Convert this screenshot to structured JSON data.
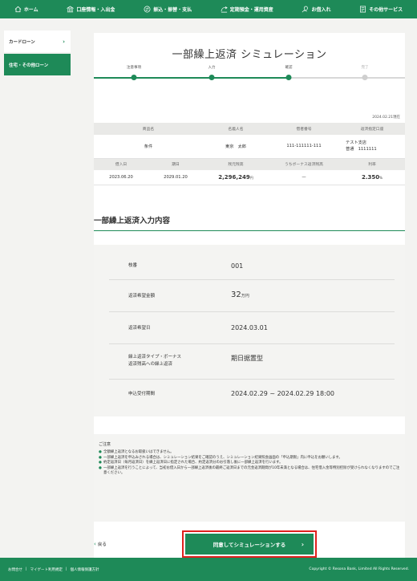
{
  "nav": {
    "items": [
      {
        "label": "ホーム",
        "icon": "home-icon"
      },
      {
        "label": "口座情報・入出金",
        "icon": "bank-icon"
      },
      {
        "label": "振込・振替・支払",
        "icon": "transfer-icon"
      },
      {
        "label": "定期預金・運用資産",
        "icon": "deposit-icon"
      },
      {
        "label": "お借入れ",
        "icon": "loan-icon"
      },
      {
        "label": "その他サービス",
        "icon": "services-icon"
      }
    ]
  },
  "sidebar": {
    "items": [
      {
        "label": "カードローン",
        "chevron": "›"
      },
      {
        "label": "住宅・その他ローン"
      }
    ]
  },
  "page": {
    "title": "一部繰上返済 シミュレーション",
    "steps": [
      {
        "label": "注意事項",
        "active": true
      },
      {
        "label": "入力",
        "active": true
      },
      {
        "label": "確認",
        "active": true
      },
      {
        "label": "完了",
        "active": false
      }
    ],
    "as_of": "2024.02.21現在"
  },
  "info_table": {
    "headers1": [
      "商品名",
      "名義人名",
      "借者番号",
      "返済指定口座"
    ],
    "product": "条件",
    "holder": "東京　太郎",
    "borrower_no": "111-111111-111",
    "account_line1": "テスト支店",
    "account_line2": "普通　1111111",
    "headers2": [
      "借入日",
      "期日",
      "残元残高",
      "うちボーナス返済残高",
      "利率"
    ],
    "loan_date": "2023.06.20",
    "due_date": "2029.01.20",
    "balance": "2,296,249",
    "balance_unit": "円",
    "bonus_balance": "—",
    "rate": "2.350",
    "rate_unit": "%"
  },
  "section": {
    "title": "一部繰上返済入力内容"
  },
  "details": {
    "branch_label": "枝番",
    "branch_value": "001",
    "amount_label": "返済希望金額",
    "amount_value": "32",
    "amount_unit": "万円",
    "date_label": "返済希望日",
    "date_value": "2024.03.01",
    "type_label_1": "繰上返済タイプ・ボーナス",
    "type_label_2": "返済残高への繰上返済",
    "type_value": "期日据置型",
    "period_label": "申込受付期間",
    "period_value": "2024.02.29 ~ 2024.02.29 18:00"
  },
  "notes": {
    "title": "ご注意",
    "items": [
      "全額繰上返済となるお取扱いはできません。",
      "一部繰上返済を申込みされる場合は、シミュレーション結果をご確認のうえ、シミュレーション結果照会画面の「申込期限」内に申込をお願いします。",
      "約定返済日（毎月返済日）を繰上返済日に指定された場合、約定返済分のお引落し後に一部繰上返済を行います。",
      "一部繰上返済を行うことによって、当初お借入日から一部繰上返済後の最終ご返済日までの元金返済期間が10年未満となる場合は、住宅借入金等特別控除が受けられなくなりますのでご注意ください。"
    ]
  },
  "actions": {
    "back_label": "戻る",
    "submit_label": "同意してシミュレーションする"
  },
  "footer": {
    "links": [
      "お問合せ",
      "マイゲート利用規定",
      "個人情報保護方針"
    ],
    "copyright": "Copyright © Resona Bank, Limited All Rights Reserved."
  },
  "colors": {
    "brand_green": "#1e8a58",
    "highlight_red": "#e0201e"
  }
}
